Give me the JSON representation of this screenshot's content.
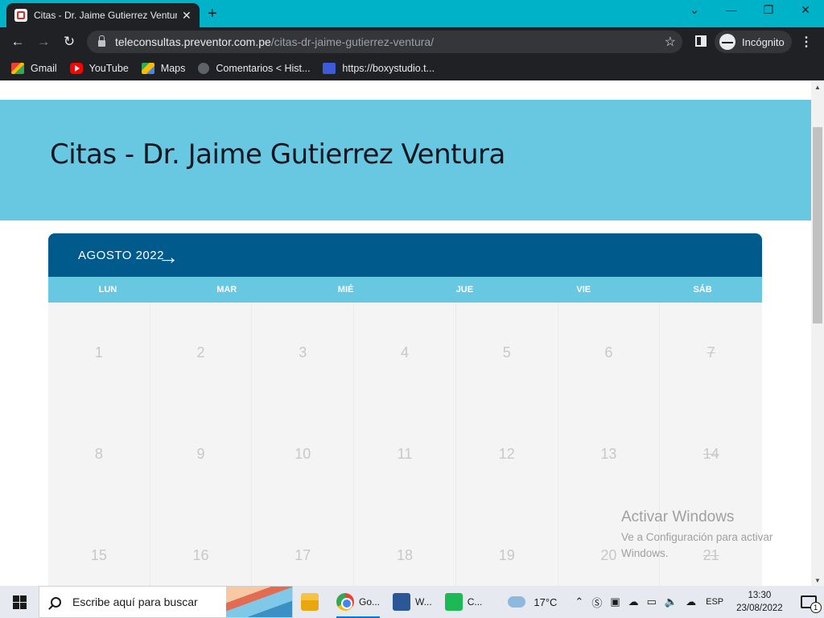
{
  "browser": {
    "tab_title": "Citas - Dr. Jaime Gutierrez Ventura",
    "url_host": "teleconsultas.preventor.com.pe",
    "url_path": "/citas-dr-jaime-gutierrez-ventura/",
    "profile_label": "Incógnito"
  },
  "bookmarks": [
    {
      "label": "Gmail",
      "icon": "gmail-icon"
    },
    {
      "label": "YouTube",
      "icon": "youtube-icon"
    },
    {
      "label": "Maps",
      "icon": "maps-icon"
    },
    {
      "label": "Comentarios < Hist...",
      "icon": "globe-icon"
    },
    {
      "label": "https://boxystudio.t...",
      "icon": "boxystudio-icon"
    }
  ],
  "page": {
    "title": "Citas - Dr. Jaime Gutierrez Ventura"
  },
  "calendar": {
    "month_label": "AGOSTO 2022",
    "weekdays": [
      "LUN",
      "MAR",
      "MIÉ",
      "JUE",
      "VIE",
      "SÁB"
    ],
    "days": [
      "1",
      "2",
      "3",
      "4",
      "5",
      "6",
      "7",
      "8",
      "9",
      "10",
      "11",
      "12",
      "13",
      "14",
      "15",
      "16",
      "17",
      "18",
      "19",
      "20",
      "21"
    ]
  },
  "watermark": {
    "title": "Activar Windows",
    "subtitle": "Ve a Configuración para activar Windows."
  },
  "taskbar": {
    "search_placeholder": "Escribe aquí para buscar",
    "apps": [
      {
        "label": "",
        "icon": "file-explorer-icon"
      },
      {
        "label": "Go...",
        "icon": "chrome-icon"
      },
      {
        "label": "W...",
        "icon": "word-icon"
      },
      {
        "label": "C...",
        "icon": "app-icon"
      }
    ],
    "temperature": "17°C",
    "language": "ESP",
    "time": "13:30",
    "date": "23/08/2022",
    "notification_count": "1"
  },
  "colors": {
    "tab_strip": "#00b2c8",
    "hero": "#68c8e2",
    "calendar_header": "#005b8c"
  }
}
